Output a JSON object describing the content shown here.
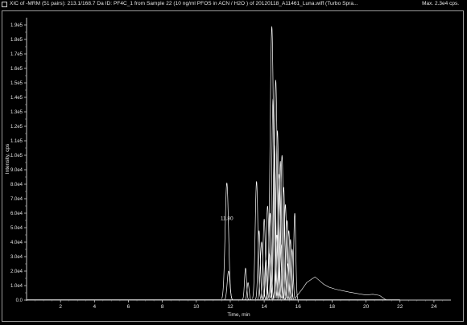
{
  "header": {
    "title": "XIC of -MRM (51 pairs): 213.1/168.7 Da ID: PF4C_1 from Sample 22 (10 ng/ml PFOS in ACN / H2O ) of 20120118_A11461_Luna.wiff (Turbo Spra...",
    "max_label": "Max. 2.3e4 cps."
  },
  "chart_data": {
    "type": "line",
    "xlabel": "Time, min",
    "ylabel": "Intensity, cps",
    "xlim": [
      0,
      25
    ],
    "ylim": [
      0,
      195000
    ],
    "x_ticks": [
      2,
      4,
      6,
      8,
      10,
      12,
      14,
      16,
      18,
      20,
      22,
      24
    ],
    "y_ticks": [
      {
        "v": 0,
        "label": "0.0"
      },
      {
        "v": 10000,
        "label": "1.0e4"
      },
      {
        "v": 20000,
        "label": "2.0e4"
      },
      {
        "v": 30000,
        "label": "3.0e4"
      },
      {
        "v": 40000,
        "label": "4.0e4"
      },
      {
        "v": 50000,
        "label": "5.0e4"
      },
      {
        "v": 60000,
        "label": "6.0e4"
      },
      {
        "v": 70000,
        "label": "7.0e4"
      },
      {
        "v": 80000,
        "label": "8.0e4"
      },
      {
        "v": 90000,
        "label": "9.0e4"
      },
      {
        "v": 100000,
        "label": "1.0e5"
      },
      {
        "v": 110000,
        "label": "1.1e5"
      },
      {
        "v": 120000,
        "label": "1.2e5"
      },
      {
        "v": 130000,
        "label": "1.3e5"
      },
      {
        "v": 140000,
        "label": "1.4e5"
      },
      {
        "v": 150000,
        "label": "1.5e5"
      },
      {
        "v": 160000,
        "label": "1.6e5"
      },
      {
        "v": 170000,
        "label": "1.7e5"
      },
      {
        "v": 180000,
        "label": "1.8e5"
      },
      {
        "v": 190000,
        "label": "1.9e5"
      }
    ],
    "peaks": [
      {
        "rt": 11.8,
        "h": 81000,
        "w": 0.1
      },
      {
        "rt": 11.9,
        "h": 20000,
        "w": 0.08
      },
      {
        "rt": 12.9,
        "h": 22000,
        "w": 0.06
      },
      {
        "rt": 13.05,
        "h": 12000,
        "w": 0.06
      },
      {
        "rt": 13.55,
        "h": 82000,
        "w": 0.08
      },
      {
        "rt": 13.7,
        "h": 48000,
        "w": 0.07
      },
      {
        "rt": 13.85,
        "h": 40000,
        "w": 0.08
      },
      {
        "rt": 14.0,
        "h": 56000,
        "w": 0.07
      },
      {
        "rt": 14.2,
        "h": 65000,
        "w": 0.08
      },
      {
        "rt": 14.35,
        "h": 60000,
        "w": 0.07
      },
      {
        "rt": 14.45,
        "h": 189000,
        "w": 0.1
      },
      {
        "rt": 14.52,
        "h": 139000,
        "w": 0.08
      },
      {
        "rt": 14.6,
        "h": 107000,
        "w": 0.08
      },
      {
        "rt": 14.68,
        "h": 152000,
        "w": 0.09
      },
      {
        "rt": 14.78,
        "h": 117000,
        "w": 0.08
      },
      {
        "rt": 14.88,
        "h": 87000,
        "w": 0.08
      },
      {
        "rt": 14.95,
        "h": 96000,
        "w": 0.07
      },
      {
        "rt": 15.05,
        "h": 100000,
        "w": 0.08
      },
      {
        "rt": 15.15,
        "h": 78000,
        "w": 0.07
      },
      {
        "rt": 15.25,
        "h": 66000,
        "w": 0.07
      },
      {
        "rt": 15.35,
        "h": 55000,
        "w": 0.07
      },
      {
        "rt": 15.45,
        "h": 48000,
        "w": 0.07
      },
      {
        "rt": 15.55,
        "h": 42000,
        "w": 0.06
      },
      {
        "rt": 15.65,
        "h": 35000,
        "w": 0.06
      },
      {
        "rt": 15.8,
        "h": 60000,
        "w": 0.06
      },
      {
        "rt": 14.1,
        "h": 28000,
        "w": 0.07
      },
      {
        "rt": 14.3,
        "h": 32000,
        "w": 0.07
      },
      {
        "rt": 14.75,
        "h": 45000,
        "w": 0.07
      },
      {
        "rt": 15.0,
        "h": 38000,
        "w": 0.07
      },
      {
        "rt": 15.4,
        "h": 25000,
        "w": 0.06
      }
    ],
    "broad_trace": {
      "x": [
        15.8,
        16.2,
        16.5,
        16.8,
        17.0,
        17.2,
        17.5,
        17.8,
        18.2,
        18.6,
        19.0,
        19.5,
        20.0,
        20.4,
        20.8,
        21.0,
        21.2
      ],
      "y": [
        1000,
        7000,
        12000,
        14500,
        16000,
        14000,
        11000,
        9000,
        7500,
        6500,
        5500,
        4500,
        3500,
        4000,
        3200,
        1500,
        0
      ]
    },
    "annotations": [
      {
        "x": 11.8,
        "y": 82000,
        "label": "11.80"
      }
    ]
  }
}
